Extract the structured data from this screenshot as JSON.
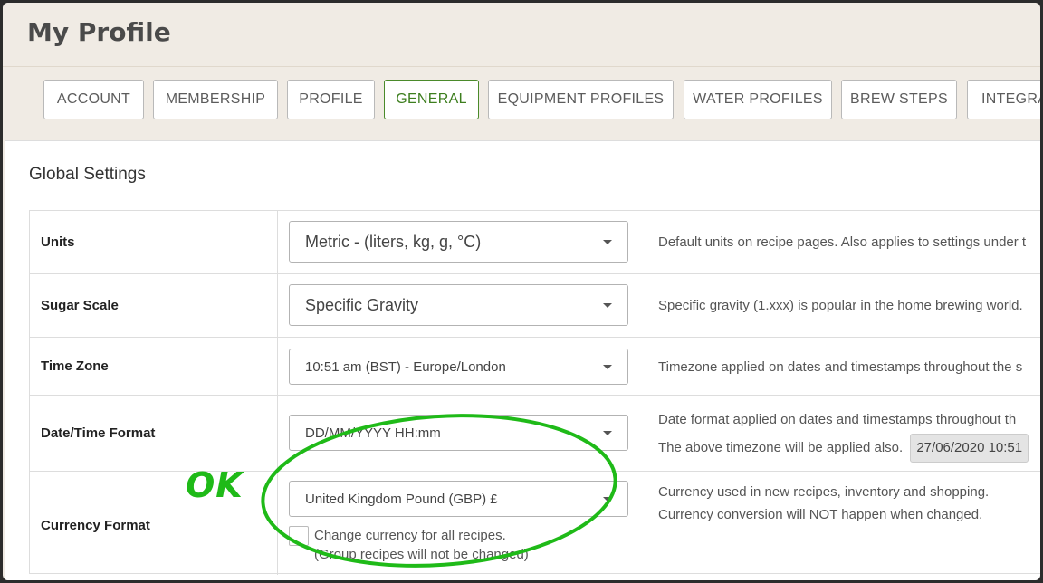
{
  "header": {
    "title": "My Profile"
  },
  "tabs": [
    {
      "label": "ACCOUNT"
    },
    {
      "label": "MEMBERSHIP"
    },
    {
      "label": "PROFILE"
    },
    {
      "label": "GENERAL",
      "active": true
    },
    {
      "label": "EQUIPMENT PROFILES"
    },
    {
      "label": "WATER PROFILES"
    },
    {
      "label": "BREW STEPS"
    },
    {
      "label": "INTEGRA"
    }
  ],
  "panel": {
    "title": "Global Settings"
  },
  "settings": {
    "units": {
      "label": "Units",
      "value": "Metric - (liters, kg, g, °C)",
      "description": "Default units on recipe pages. Also applies to settings under t"
    },
    "sugar_scale": {
      "label": "Sugar Scale",
      "value": "Specific Gravity",
      "description": "Specific gravity (1.xxx) is popular in the home brewing world."
    },
    "time_zone": {
      "label": "Time Zone",
      "value": "10:51 am (BST) - Europe/London",
      "description": "Timezone applied on dates and timestamps throughout the s"
    },
    "date_format": {
      "label": "Date/Time Format",
      "value": "DD/MM/YYYY HH:mm",
      "description_line1": "Date format applied on dates and timestamps throughout th",
      "description_line2": "The above timezone will be applied also.",
      "preview": "27/06/2020 10:51"
    },
    "currency": {
      "label": "Currency Format",
      "value": "United Kingdom Pound (GBP) £",
      "description_line1": "Currency used in new recipes, inventory and shopping.",
      "description_line2": "Currency conversion will NOT happen when changed.",
      "checkbox_line1": "Change currency for all recipes.",
      "checkbox_line2": "(Group recipes will not be changed)",
      "checkbox_checked": false
    }
  },
  "annotation": {
    "text": "OK",
    "color": "#1fba18"
  },
  "colors": {
    "active_tab": "#3d7e1e",
    "header_bg": "#f0ebe4"
  }
}
